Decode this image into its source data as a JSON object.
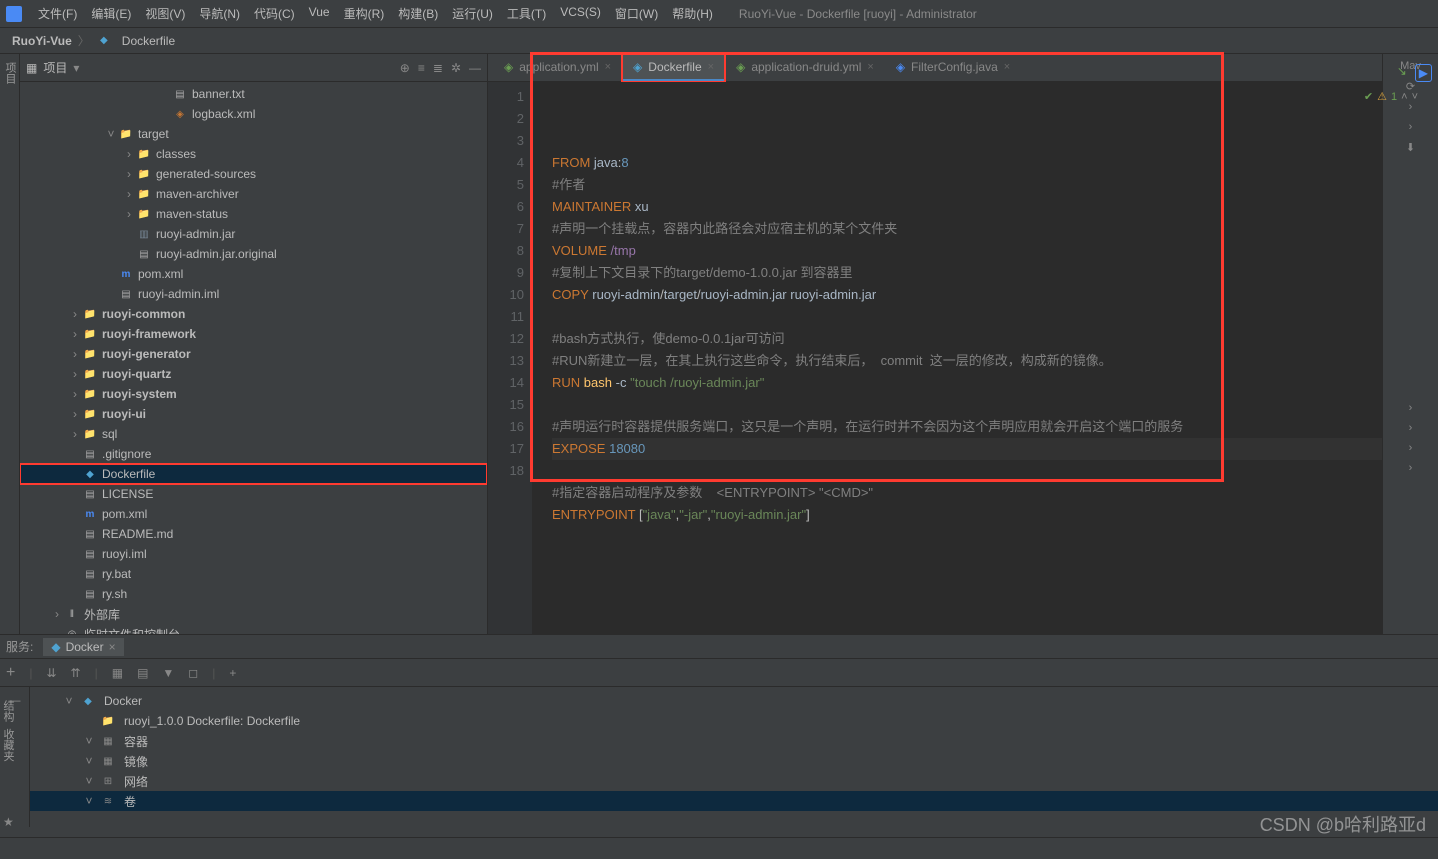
{
  "title": "RuoYi-Vue - Dockerfile [ruoyi] - Administrator",
  "menu": [
    "文件(F)",
    "编辑(E)",
    "视图(V)",
    "导航(N)",
    "代码(C)",
    "Vue",
    "重构(R)",
    "构建(B)",
    "运行(U)",
    "工具(T)",
    "VCS(S)",
    "窗口(W)",
    "帮助(H)"
  ],
  "breadcrumb": {
    "root": "RuoYi-Vue",
    "file": "Dockerfile"
  },
  "panel": {
    "title": "项目"
  },
  "tree": [
    {
      "d": 6,
      "a": "",
      "i": "file",
      "l": "banner.txt"
    },
    {
      "d": 6,
      "a": "",
      "i": "xml",
      "l": "logback.xml"
    },
    {
      "d": 3,
      "a": "v",
      "i": "folder",
      "l": "target"
    },
    {
      "d": 4,
      "a": ">",
      "i": "folder",
      "l": "classes"
    },
    {
      "d": 4,
      "a": ">",
      "i": "folder",
      "l": "generated-sources"
    },
    {
      "d": 4,
      "a": ">",
      "i": "folder",
      "l": "maven-archiver"
    },
    {
      "d": 4,
      "a": ">",
      "i": "folder",
      "l": "maven-status"
    },
    {
      "d": 4,
      "a": "",
      "i": "jar",
      "l": "ruoyi-admin.jar"
    },
    {
      "d": 4,
      "a": "",
      "i": "file",
      "l": "ruoyi-admin.jar.original"
    },
    {
      "d": 3,
      "a": "",
      "i": "maven",
      "l": "pom.xml"
    },
    {
      "d": 3,
      "a": "",
      "i": "file",
      "l": "ruoyi-admin.iml"
    },
    {
      "d": 1,
      "a": ">",
      "i": "folder-mod",
      "l": "ruoyi-common",
      "b": true
    },
    {
      "d": 1,
      "a": ">",
      "i": "folder-mod",
      "l": "ruoyi-framework",
      "b": true
    },
    {
      "d": 1,
      "a": ">",
      "i": "folder-mod",
      "l": "ruoyi-generator",
      "b": true
    },
    {
      "d": 1,
      "a": ">",
      "i": "folder-mod",
      "l": "ruoyi-quartz",
      "b": true
    },
    {
      "d": 1,
      "a": ">",
      "i": "folder-mod",
      "l": "ruoyi-system",
      "b": true
    },
    {
      "d": 1,
      "a": ">",
      "i": "folder-mod",
      "l": "ruoyi-ui",
      "b": true
    },
    {
      "d": 1,
      "a": ">",
      "i": "folder",
      "l": "sql"
    },
    {
      "d": 1,
      "a": "",
      "i": "file",
      "l": ".gitignore"
    },
    {
      "d": 1,
      "a": "",
      "i": "docker",
      "l": "Dockerfile",
      "sel": true,
      "hl": true
    },
    {
      "d": 1,
      "a": "",
      "i": "file",
      "l": "LICENSE"
    },
    {
      "d": 1,
      "a": "",
      "i": "maven",
      "l": "pom.xml"
    },
    {
      "d": 1,
      "a": "",
      "i": "file",
      "l": "README.md"
    },
    {
      "d": 1,
      "a": "",
      "i": "file",
      "l": "ruoyi.iml"
    },
    {
      "d": 1,
      "a": "",
      "i": "file",
      "l": "ry.bat"
    },
    {
      "d": 1,
      "a": "",
      "i": "file",
      "l": "ry.sh"
    },
    {
      "d": 0,
      "a": ">",
      "i": "lib",
      "l": "外部库"
    },
    {
      "d": 0,
      "a": "",
      "i": "scratch",
      "l": "临时文件和控制台"
    }
  ],
  "tabs": [
    {
      "l": "application.yml",
      "a": false
    },
    {
      "l": "Dockerfile",
      "a": true,
      "hl": true
    },
    {
      "l": "application-druid.yml",
      "a": false
    },
    {
      "l": "FilterConfig.java",
      "a": false
    }
  ],
  "code": {
    "lines": [
      {
        "n": 1,
        "h": "<span class='cmd'>FROM</span> <span class='id'>java</span>:<span class='num'>8</span>"
      },
      {
        "n": 2,
        "h": "<span class='cmt'>#作者</span>"
      },
      {
        "n": 3,
        "h": "<span class='cmd'>MAINTAINER</span> <span class='id'>xu</span>"
      },
      {
        "n": 4,
        "h": "<span class='cmt'>#声明一个挂载点，容器内此路径会对应宿主机的某个文件夹</span>"
      },
      {
        "n": 5,
        "h": "<span class='cmd'>VOLUME</span> <span class='path'>/tmp</span>"
      },
      {
        "n": 6,
        "h": "<span class='cmt'>#复制上下文目录下的target/demo-1.0.0.jar 到容器里</span>"
      },
      {
        "n": 7,
        "h": "<span class='cmd'>COPY</span> <span class='id'>ruoyi-admin</span>/<span class='id'>target</span>/<span class='id'>ruoyi-admin.jar</span> <span class='id'>ruoyi-admin.jar</span>"
      },
      {
        "n": 8,
        "h": ""
      },
      {
        "n": 9,
        "h": "<span class='cmt'>#bash方式执行，使demo-0.0.1jar可访问</span>"
      },
      {
        "n": 10,
        "h": "<span class='cmt'>#RUN新建立一层，在其上执行这些命令，执行结束后，  commit  这一层的修改，构成新的镜像。</span>"
      },
      {
        "n": 11,
        "h": "<span class='cmd'>RUN</span> <span class='fn'>bash</span> <span class='id'>-c</span> <span class='str'>\"touch /ruoyi-admin.jar\"</span>"
      },
      {
        "n": 12,
        "h": ""
      },
      {
        "n": 13,
        "h": "<span class='cmt'>#声明运行时容器提供服务端口，这只是一个声明，在运行时并不会因为这个声明应用就会开启这个端口的服务</span>"
      },
      {
        "n": 14,
        "h": "<span class='cmd'>EXPOSE</span> <span class='num'>18080</span>",
        "cur": true
      },
      {
        "n": 15,
        "h": ""
      },
      {
        "n": 16,
        "h": "<span class='cmt'>#指定容器启动程序及参数    &lt;ENTRYPOINT&gt; \"&lt;CMD&gt;\"</span>"
      },
      {
        "n": 17,
        "h": "<span class='cmd'>ENTRYPOINT</span> [<span class='str'>\"java\"</span>,<span class='str'>\"-jar\"</span>,<span class='str'>\"ruoyi-admin.jar\"</span>]"
      },
      {
        "n": 18,
        "h": ""
      }
    ]
  },
  "inspection": {
    "warn_count": "1"
  },
  "right_tool": "Mav",
  "services": {
    "label": "服务:",
    "tab": "Docker",
    "tree": [
      {
        "d": 0,
        "a": "v",
        "i": "docker",
        "l": "Docker"
      },
      {
        "d": 1,
        "a": "",
        "i": "folder",
        "l": "ruoyi_1.0.0 Dockerfile: Dockerfile"
      },
      {
        "d": 1,
        "a": "v",
        "i": "grid",
        "l": "容器"
      },
      {
        "d": 1,
        "a": "v",
        "i": "grid",
        "l": "镜像"
      },
      {
        "d": 1,
        "a": "v",
        "i": "net",
        "l": "网络"
      },
      {
        "d": 1,
        "a": "v",
        "i": "vol",
        "l": "卷",
        "sel": true
      }
    ]
  },
  "left_vert_labels": [
    "结构",
    "收藏夹"
  ],
  "watermark": "CSDN @b哈利路亚d"
}
